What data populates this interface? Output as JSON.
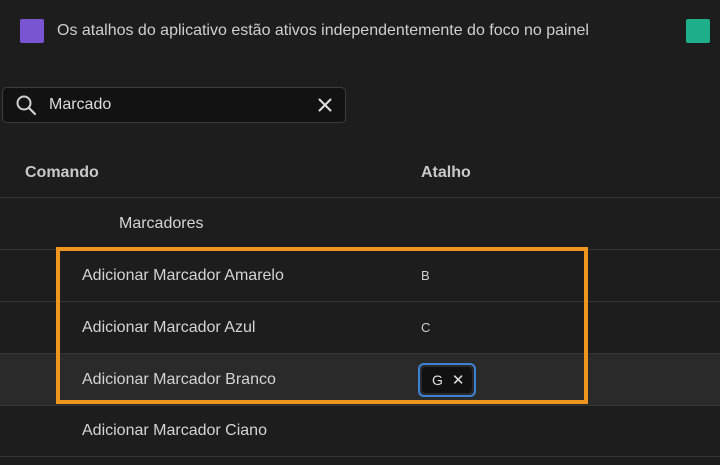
{
  "legend": {
    "text": "Os atalhos do aplicativo estão ativos independentemente do foco no painel",
    "swatch_color": "#7a55d1",
    "secondary_swatch_color": "#1fae8a"
  },
  "search": {
    "value": "Marcado",
    "icon": "search-icon",
    "clear_icon": "close-icon"
  },
  "table": {
    "headers": {
      "command": "Comando",
      "shortcut": "Atalho"
    },
    "group": "Marcadores",
    "rows": [
      {
        "command": "Adicionar Marcador Amarelo",
        "shortcut": "B"
      },
      {
        "command": "Adicionar Marcador Azul",
        "shortcut": "C"
      },
      {
        "command": "Adicionar Marcador Branco",
        "shortcut": "G",
        "editing": true
      },
      {
        "command": "Adicionar Marcador Ciano",
        "shortcut": ""
      }
    ]
  },
  "colors": {
    "highlight": "#f0951f",
    "focus_ring": "#3b83d6"
  }
}
